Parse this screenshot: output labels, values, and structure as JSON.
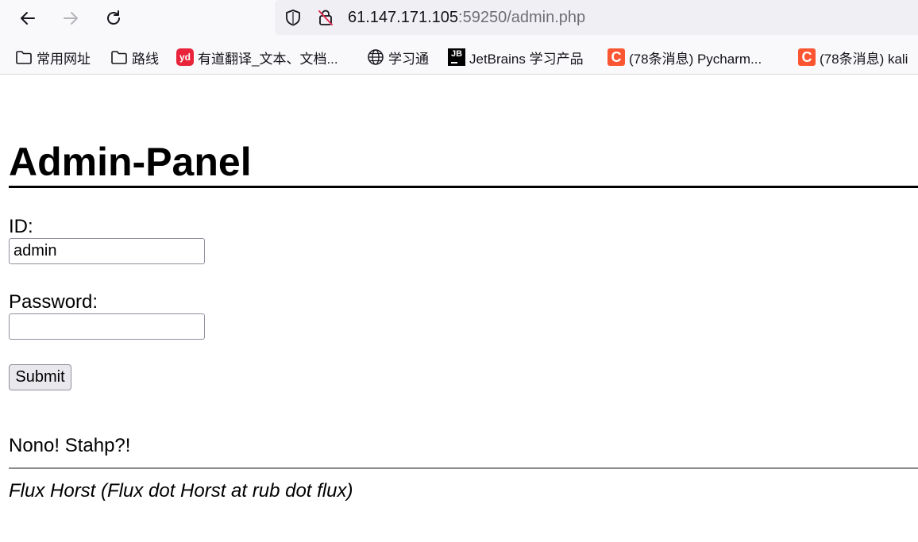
{
  "browser": {
    "url_host": "61.147.171.105",
    "url_rest": ":59250/admin.php",
    "icons": {
      "back": "arrow-left-icon",
      "forward": "arrow-right-icon",
      "reload": "reload-icon",
      "tracking": "shield-icon",
      "security": "insecure-lock-icon"
    }
  },
  "bookmarks": [
    {
      "label": "常用网址",
      "icon": "folder-icon"
    },
    {
      "label": "路线",
      "icon": "folder-icon"
    },
    {
      "label": "有道翻译_文本、文档...",
      "icon": "youdao-icon",
      "icon_text": "yd"
    },
    {
      "label": "学习通",
      "icon": "globe-icon"
    },
    {
      "label": "JetBrains 学习产品",
      "icon": "jetbrains-icon",
      "icon_text": "JB"
    },
    {
      "label": "(78条消息) Pycharm...",
      "icon": "csdn-icon",
      "icon_text": "C"
    },
    {
      "label": "(78条消息) kali",
      "icon": "csdn-icon",
      "icon_text": "C"
    }
  ],
  "page": {
    "title": "Admin-Panel",
    "id_label": "ID:",
    "id_value": "admin",
    "password_label": "Password:",
    "password_value": "",
    "submit_label": "Submit",
    "message": "Nono! Stahp?!",
    "footer": "Flux Horst (Flux dot Horst at rub dot flux)"
  },
  "colors": {
    "chrome_bg": "#f9f9fb",
    "urlbar_bg": "#f0f0f4",
    "youdao": "#e8233a",
    "csdn": "#fc5531"
  }
}
